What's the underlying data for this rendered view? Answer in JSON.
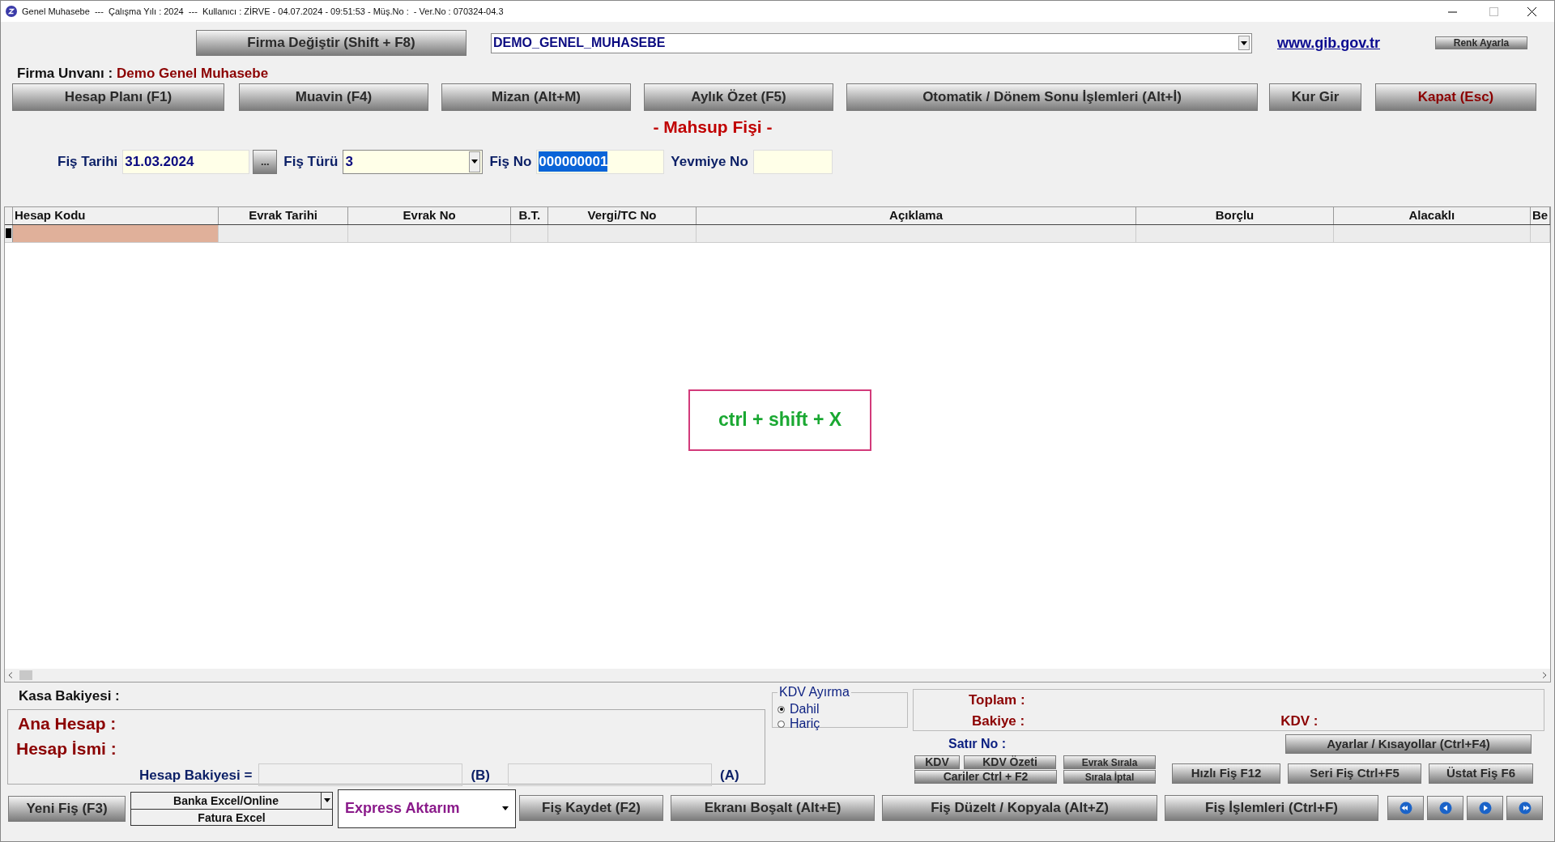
{
  "window": {
    "title": "Genel Muhasebe  ---  Çalışma Yılı : 2024  ---  Kullanıcı : ZİRVE - 04.07.2024 - 09:51:53 - Müş.No :  - Ver.No : 070324-04.3"
  },
  "top": {
    "firma_button": "Firma Değiştir (Shift + F8)",
    "company": "DEMO_GENEL_MUHASEBE",
    "link": "www.gib.gov.tr",
    "color_button": "Renk Ayarla"
  },
  "firma_unvani": {
    "label": "Firma Unvanı :",
    "value": "Demo Genel Muhasebe"
  },
  "nav_buttons": [
    {
      "label": "Hesap Planı (F1)",
      "kind": "normal"
    },
    {
      "label": "Muavin (F4)",
      "kind": "normal"
    },
    {
      "label": "Mizan (Alt+M)",
      "kind": "normal"
    },
    {
      "label": "Aylık Özet (F5)",
      "kind": "normal"
    },
    {
      "label": "Otomatik / Dönem Sonu İşlemleri (Alt+İ)",
      "kind": "normal"
    },
    {
      "label": "Kur Gir",
      "kind": "normal"
    },
    {
      "label": "Kapat (Esc)",
      "kind": "danger"
    }
  ],
  "form_title": "- Mahsup Fişi -",
  "fields": [
    {
      "label": "Fiş Tarihi",
      "value": "31.03.2024",
      "kind": "date",
      "button": "..."
    },
    {
      "label": "Fiş Türü",
      "value": "3",
      "kind": "select"
    },
    {
      "label": "Fiş No",
      "value": "000000001",
      "kind": "selected"
    },
    {
      "label": "Yevmiye No",
      "kind": "text"
    }
  ],
  "table": {
    "columns": [
      "Hesap Kodu",
      "Evrak Tarihi",
      "Evrak No",
      "B.T.",
      "Vergi/TC No",
      "Açıklama",
      "Borçlu",
      "Alacaklı",
      "Be"
    ],
    "rows": [
      {
        "current": true
      }
    ]
  },
  "hint": "ctrl + shift + X",
  "account": {
    "kasa_bakiyesi": "Kasa Bakiyesi :",
    "ana_hesap": "Ana Hesap :",
    "hesap_ismi": "Hesap İsmi :",
    "hesap_bakiyesi": "Hesap Bakiyesi =",
    "b": "(B)",
    "a": "(A)"
  },
  "kdv_ayirma": {
    "legend": "KDV Ayırma",
    "options": [
      {
        "label": "Dahil",
        "selected": true
      },
      {
        "label": "Hariç",
        "selected": false
      }
    ]
  },
  "totals": {
    "toplam": "Toplam :",
    "bakiye": "Bakiye :",
    "kdv": "KDV :",
    "satir_no": "Satır No :"
  },
  "small_buttons": {
    "kdv": "KDV",
    "kdv_ozeti": "KDV Özeti",
    "cariler": "Cariler Ctrl + F2",
    "evrak_sirala": "Evrak Sırala",
    "sirala_iptal": "Sırala İptal"
  },
  "settings_button": "Ayarlar / Kısayollar (Ctrl+F4)",
  "quick_buttons": [
    "Hızlı Fiş F12",
    "Seri Fiş Ctrl+F5",
    "Üstat Fiş F6"
  ],
  "bottom": {
    "new_button": "Yeni Fiş (F3)",
    "excel_options": [
      "Banka Excel/Online",
      "Fatura Excel"
    ],
    "express": "Express Aktarım",
    "buttons": [
      "Fiş Kaydet (F2)",
      "Ekranı Boşalt (Alt+E)",
      "Fiş Düzelt / Kopyala (Alt+Z)",
      "Fiş İşlemleri (Ctrl+F)"
    ],
    "navigation": [
      {
        "kind": "first"
      },
      {
        "kind": "prev"
      },
      {
        "kind": "next"
      },
      {
        "kind": "last"
      }
    ]
  }
}
